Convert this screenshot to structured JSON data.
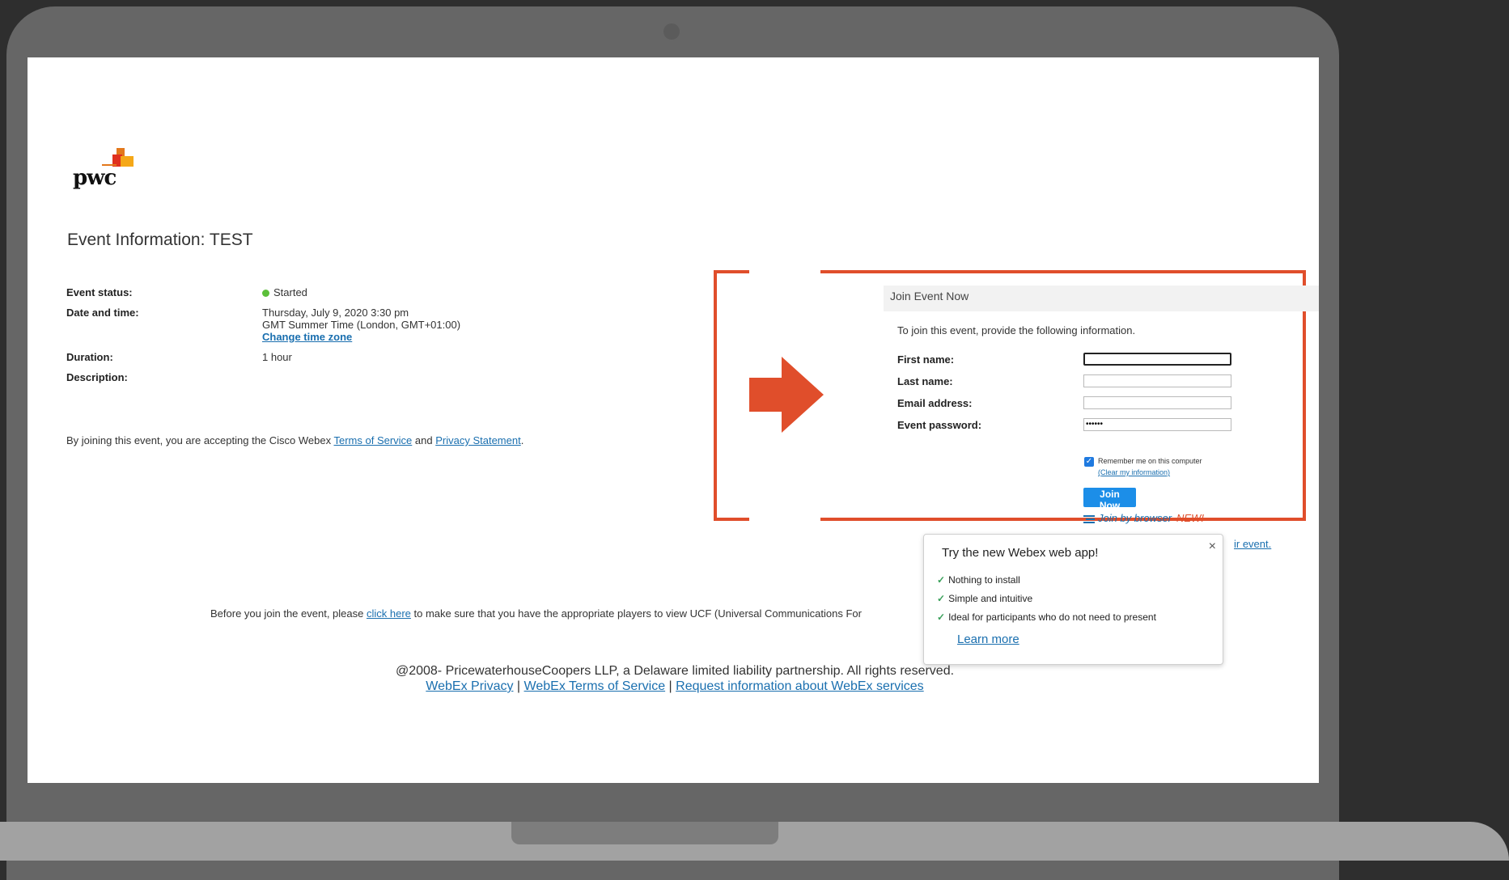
{
  "header": {
    "logo_text": "pwc"
  },
  "page": {
    "title": "Event Information: TEST"
  },
  "event": {
    "status_label": "Event status:",
    "status_value": "Started",
    "date_label": "Date and time:",
    "date_line1": "Thursday, July 9, 2020 3:30 pm",
    "date_line2": "GMT Summer Time (London, GMT+01:00)",
    "change_tz": "Change time zone",
    "duration_label": "Duration:",
    "duration_value": "1 hour",
    "description_label": "Description:"
  },
  "accept": {
    "prefix": "By joining this event, you are accepting the Cisco Webex ",
    "tos": "Terms of Service",
    "and": " and ",
    "privacy": "Privacy Statement",
    "suffix": "."
  },
  "join_form": {
    "title": "Join Event Now",
    "intro": "To join this event, provide the following information.",
    "first_name_label": "First name:",
    "last_name_label": "Last name:",
    "email_label": "Email address:",
    "password_label": "Event password:",
    "password_value": "••••••",
    "remember_label": "Remember me on this computer",
    "clear_label": "(Clear my information)",
    "join_button": "Join Now",
    "browser_join": "Join by browser",
    "browser_new": "NEW!",
    "partial_link": "ir event."
  },
  "popup": {
    "title": "Try the new Webex web app!",
    "items": [
      "Nothing to install",
      "Simple and intuitive",
      "Ideal for participants who do not need to present"
    ],
    "learn_more": "Learn more",
    "close": "×"
  },
  "ucf": {
    "prefix": "Before you join the event, please ",
    "link": "click here",
    "suffix": " to make sure that you have the appropriate players to view UCF (Universal Communications For"
  },
  "footer": {
    "copyright": "@2008- PricewaterhouseCoopers LLP, a Delaware limited liability partnership. All rights reserved.",
    "link1": "WebEx Privacy",
    "sep": " | ",
    "link2": "WebEx Terms of Service",
    "link3": "Request information about WebEx services"
  },
  "colors": {
    "accent_red": "#e04e2b",
    "link_blue": "#1a6faf",
    "button_blue": "#1c8ee8"
  }
}
